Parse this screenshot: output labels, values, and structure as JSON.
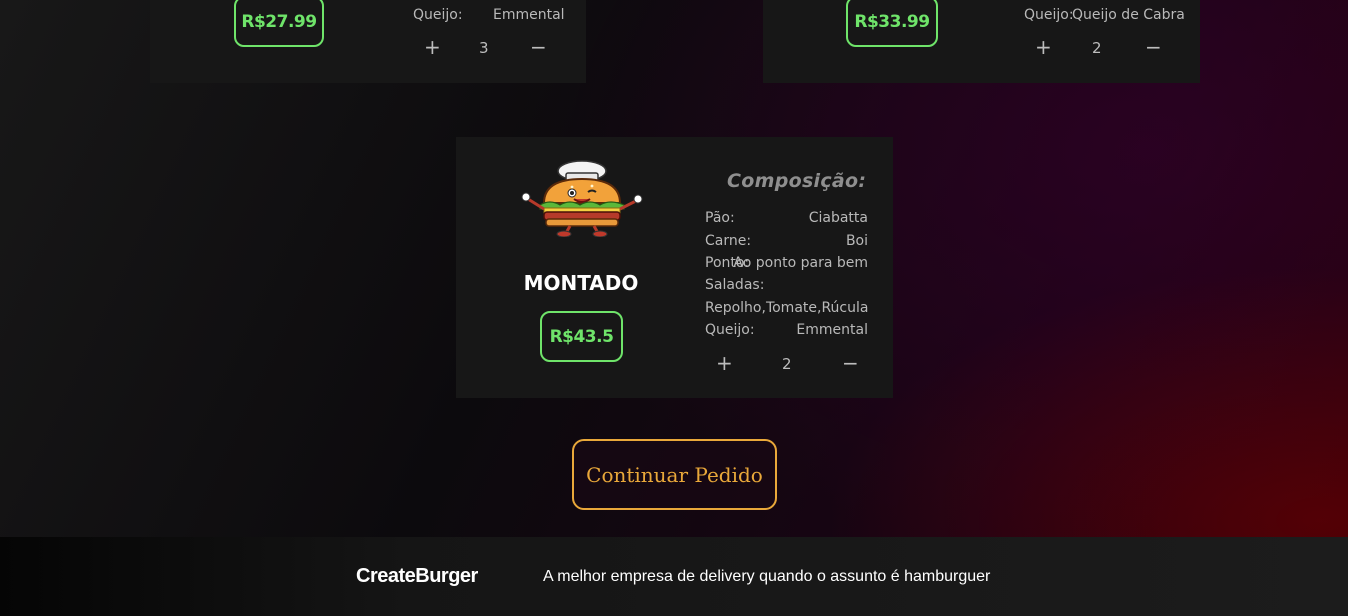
{
  "cards": {
    "top_left": {
      "price": "R$27.99",
      "queijo_label": "Queijo:",
      "queijo_value": "Emmental",
      "quantity": "3",
      "plus": "+",
      "minus": "−"
    },
    "top_right": {
      "price": "R$33.99",
      "queijo_label": "Queijo:",
      "queijo_value": "Queijo de Cabra",
      "quantity": "2",
      "plus": "+",
      "minus": "−"
    },
    "main": {
      "name": "MONTADO",
      "price": "R$43.5",
      "composition_title": "Composição:",
      "rows": {
        "pao_label": "Pão:",
        "pao_value": "Ciabatta",
        "carne_label": "Carne:",
        "carne_value": "Boi",
        "ponto_label": "Ponto:",
        "ponto_value": "Ao ponto para bem",
        "saladas_label": "Saladas:",
        "saladas_value": "Repolho,Tomate,Rúcula",
        "queijo_label": "Queijo:",
        "queijo_value": "Emmental"
      },
      "quantity": "2",
      "plus": "+",
      "minus": "−",
      "mascot_icon": "burger-chef-mascot-icon"
    }
  },
  "continue_button": "Continuar Pedido",
  "footer": {
    "brand": "CreateBurger",
    "tagline": "A melhor empresa de delivery quando o assunto é hamburguer"
  },
  "colors": {
    "price_green": "#6fe46a",
    "accent_orange": "#e9a83a",
    "card_bg": "#171717"
  }
}
